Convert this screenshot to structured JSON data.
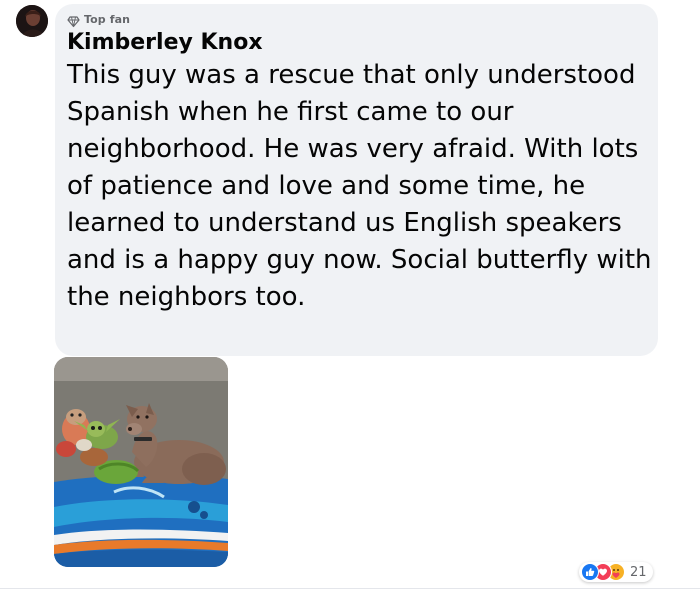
{
  "comment": {
    "badge": {
      "icon": "diamond-icon",
      "label": "Top fan"
    },
    "author": "Kimberley Knox",
    "text": "This guy was a rescue that only understood Spanish when he first came to our neighborhood. He was very afraid. With lots of patience and love and some time, he learned to understand us English speakers and is a happy guy now. Social butterfly with the neighbors too.",
    "avatar_icon": "profile-photo",
    "photo_icon": "dog-photo"
  },
  "reactions": {
    "icons": [
      "like-icon",
      "love-icon",
      "care-icon"
    ],
    "count": "21"
  },
  "colors": {
    "bubble_bg": "#f0f2f5",
    "meta_text": "#65676b",
    "like": "#1877f2",
    "love": "#f33e58",
    "care": "#f7b125"
  }
}
